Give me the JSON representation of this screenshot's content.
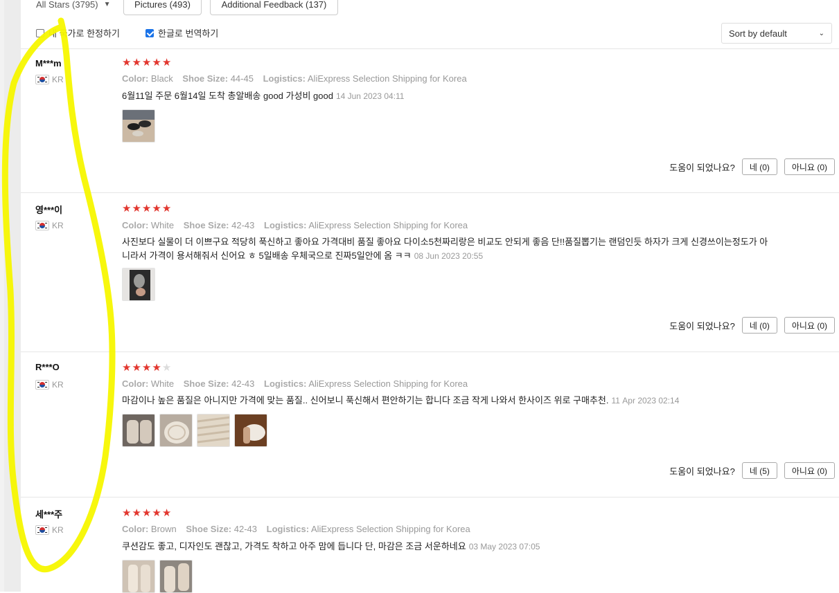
{
  "filters": {
    "stars_label": "All Stars (3795)",
    "pictures_label": "Pictures (493)",
    "feedback_label": "Additional Feedback (137)",
    "country_only_label": "내 국가로 한정하기",
    "country_only_checked": false,
    "translate_label": "한글로 번역하기",
    "translate_checked": true,
    "sort_label": "Sort by default"
  },
  "labels": {
    "color": "Color:",
    "shoe_size": "Shoe Size:",
    "logistics": "Logistics:",
    "helpful_question": "도움이 되었나요?"
  },
  "reviews": [
    {
      "user": "M***m",
      "country": "KR",
      "rating": 5,
      "color": "Black",
      "shoe_size": "44-45",
      "logistics": "AliExpress Selection Shipping for Korea",
      "text": "6월11일 주문 6월14일 도착 총알배송 good 가성비 good",
      "date": "14 Jun 2023 04:11",
      "yes": "네 (0)",
      "no": "아니요 (0)",
      "photos": [
        "slippers-black-pair"
      ]
    },
    {
      "user": "영***이",
      "country": "KR",
      "rating": 5,
      "color": "White",
      "shoe_size": "42-43",
      "logistics": "AliExpress Selection Shipping for Korea",
      "text": "사진보다 실물이 더 이쁘구요 적당히 푹신하고 좋아요 가격대비 품질 좋아요 다이소5천짜리랑은 비교도 안되게 좋음 단!!품질뽑기는 랜덤인듯 하자가 크게 신경쓰이는정도가 아니라서 가격이 용서해줘서 신어요 ㅎ 5일배송 우체국으로 진짜5일안에 옴 ㅋㅋ",
      "date": "08 Jun 2023 20:55",
      "yes": "네 (0)",
      "no": "아니요 (0)",
      "photos": [
        "slipper-on-foot"
      ]
    },
    {
      "user": "R***O",
      "country": "KR",
      "rating": 4,
      "color": "White",
      "shoe_size": "42-43",
      "logistics": "AliExpress Selection Shipping for Korea",
      "text": "마감이나 높은 품질은 아니지만 가격에 맞는 품질.. 신어보니 푹신해서 편안하기는 합니다 조금 작게 나와서 한사이즈 위로 구매추천.",
      "date": "11 Apr 2023 02:14",
      "yes": "네 (5)",
      "no": "아니요 (0)",
      "photos": [
        "slipper-top",
        "slipper-sole",
        "slipper-sole-closeup",
        "slipper-on-floor"
      ]
    },
    {
      "user": "세***주",
      "country": "KR",
      "rating": 5,
      "color": "Brown",
      "shoe_size": "42-43",
      "logistics": "AliExpress Selection Shipping for Korea",
      "text": "쿠션감도 좋고, 디자인도 괜찮고, 가격도 착하고 아주 맘에 듭니다 단, 마감은 조금 서운하네요",
      "date": "03 May 2023 07:05",
      "yes": "",
      "no": "",
      "photos": [
        "slipper-worn-1",
        "slipper-worn-2"
      ]
    }
  ],
  "colors": {
    "star_active": "#e2372f",
    "star_inactive": "#dcdcdc",
    "checkbox_checked": "#1a73e8",
    "highlight_stroke": "#f7f700"
  }
}
